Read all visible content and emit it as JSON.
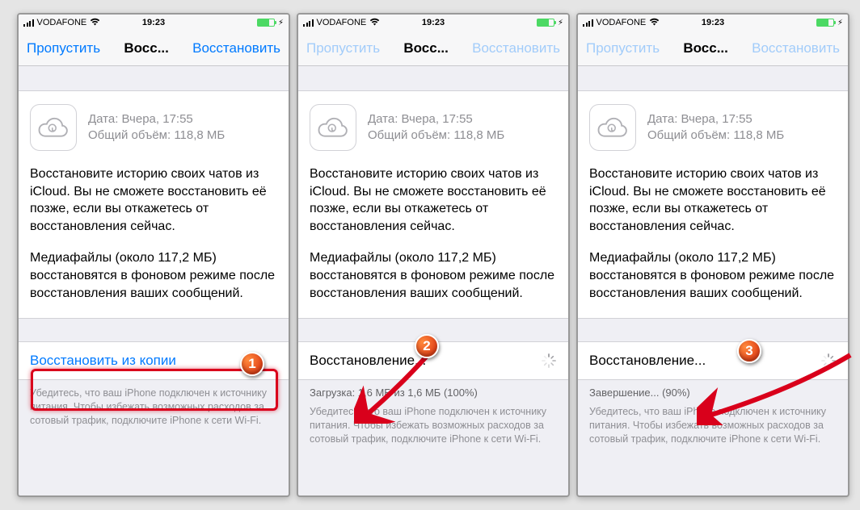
{
  "statusbar": {
    "carrier": "VODAFONE",
    "time": "19:23"
  },
  "nav": {
    "left": "Пропустить",
    "center": "Восс...",
    "right": "Восстановить"
  },
  "card": {
    "date_label": "Дата: Вчера, 17:55",
    "size_label": "Общий объём: 118,8 МБ",
    "para1": "Восстановите историю своих чатов из iCloud. Вы не сможете восстановить её позже, если вы откажетесь от восстановления сейчас.",
    "para2": "Медиафайлы (около 117,2 МБ) восстановятся в фоновом режиме после восстановления ваших сообщений."
  },
  "screen1": {
    "action": "Восстановить из копии",
    "footnote": "Убедитесь, что ваш iPhone подключен к источнику питания. Чтобы избежать возможных расходов за сотовый трафик, подключите iPhone к сети Wi-Fi."
  },
  "screen2": {
    "action": "Восстановление...",
    "progress": "Загрузка: 1,6 МБ из 1,6 МБ (100%)",
    "footnote": "Убедитесь, что ваш iPhone подключен к источнику питания. Чтобы избежать возможных расходов за сотовый трафик, подключите iPhone к сети Wi-Fi."
  },
  "screen3": {
    "action": "Восстановление...",
    "progress": "Завершение... (90%)",
    "footnote": "Убедитесь, что ваш iPhone подключен к источнику питания. Чтобы избежать возможных расходов за сотовый трафик, подключите iPhone к сети Wi-Fi."
  },
  "badges": {
    "b1": "1",
    "b2": "2",
    "b3": "3"
  }
}
